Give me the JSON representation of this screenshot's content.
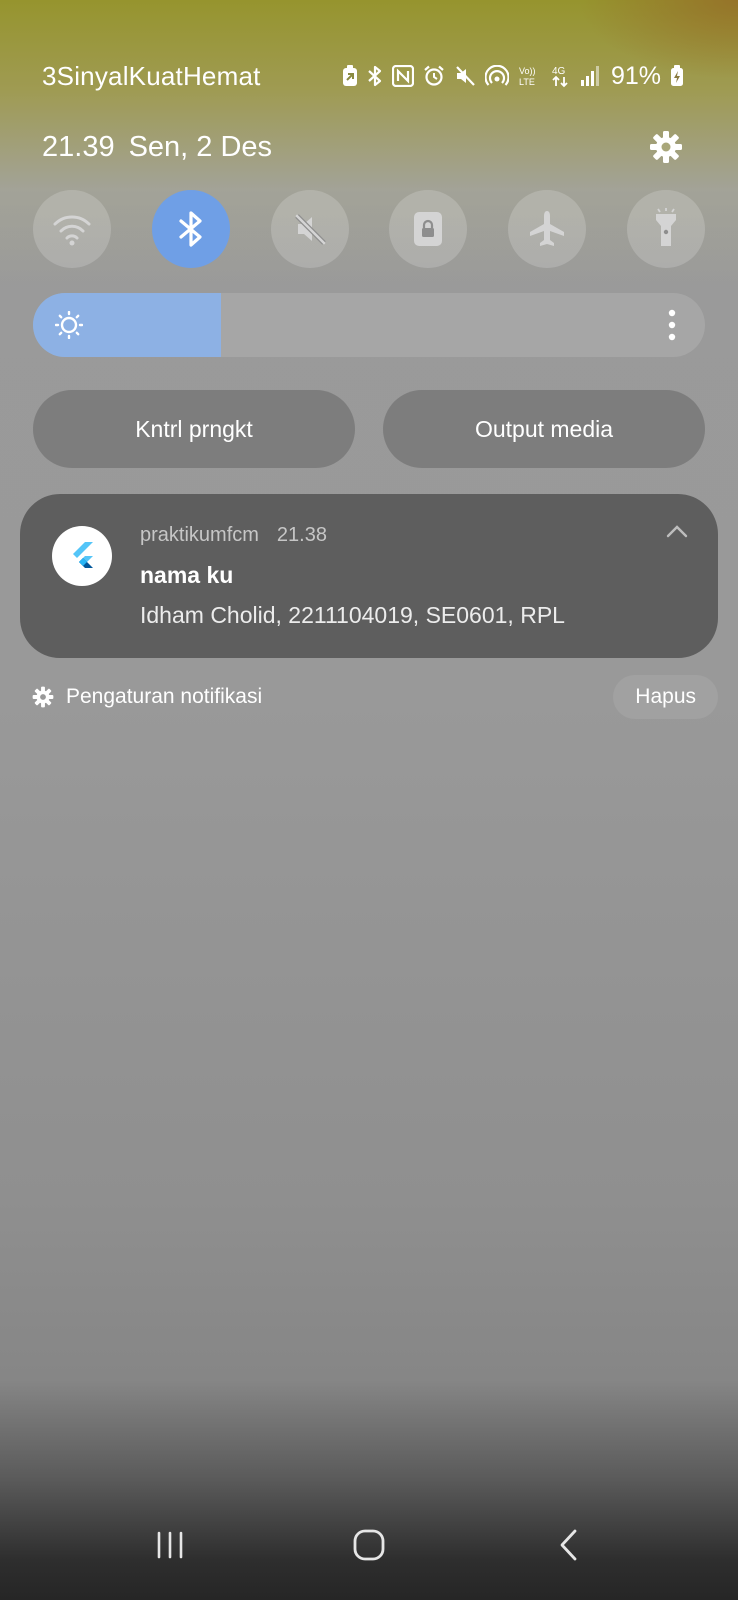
{
  "status_bar": {
    "carrier": "3SinyalKuatHemat",
    "icons": [
      "battery-saver-icon",
      "bluetooth-icon",
      "nfc-icon",
      "alarm-icon",
      "mute-icon",
      "hotspot-icon",
      "volte-icon",
      "4g-data-icon",
      "signal-icon"
    ],
    "battery_percent": "91%"
  },
  "header": {
    "time": "21.39",
    "date": "Sen, 2 Des"
  },
  "quick_tiles": [
    {
      "name": "wifi",
      "icon": "wifi-icon",
      "active": false
    },
    {
      "name": "bluetooth",
      "icon": "bluetooth-icon",
      "active": true
    },
    {
      "name": "sound",
      "icon": "mute-icon",
      "active": false
    },
    {
      "name": "rotation-lock",
      "icon": "lock-icon",
      "active": false
    },
    {
      "name": "airplane",
      "icon": "airplane-icon",
      "active": false
    },
    {
      "name": "flashlight",
      "icon": "flashlight-icon",
      "active": false
    }
  ],
  "brightness": {
    "level": 0.28,
    "accent": "#8db1e4"
  },
  "buttons": {
    "device_control": "Kntrl prngkt",
    "media_output": "Output media"
  },
  "notification": {
    "app_name": "praktikumfcm",
    "time": "21.38",
    "title": "nama ku",
    "body": "Idham Cholid, 2211104019, SE0601, RPL"
  },
  "footer": {
    "settings_label": "Pengaturan notifikasi",
    "clear_label": "Hapus"
  }
}
